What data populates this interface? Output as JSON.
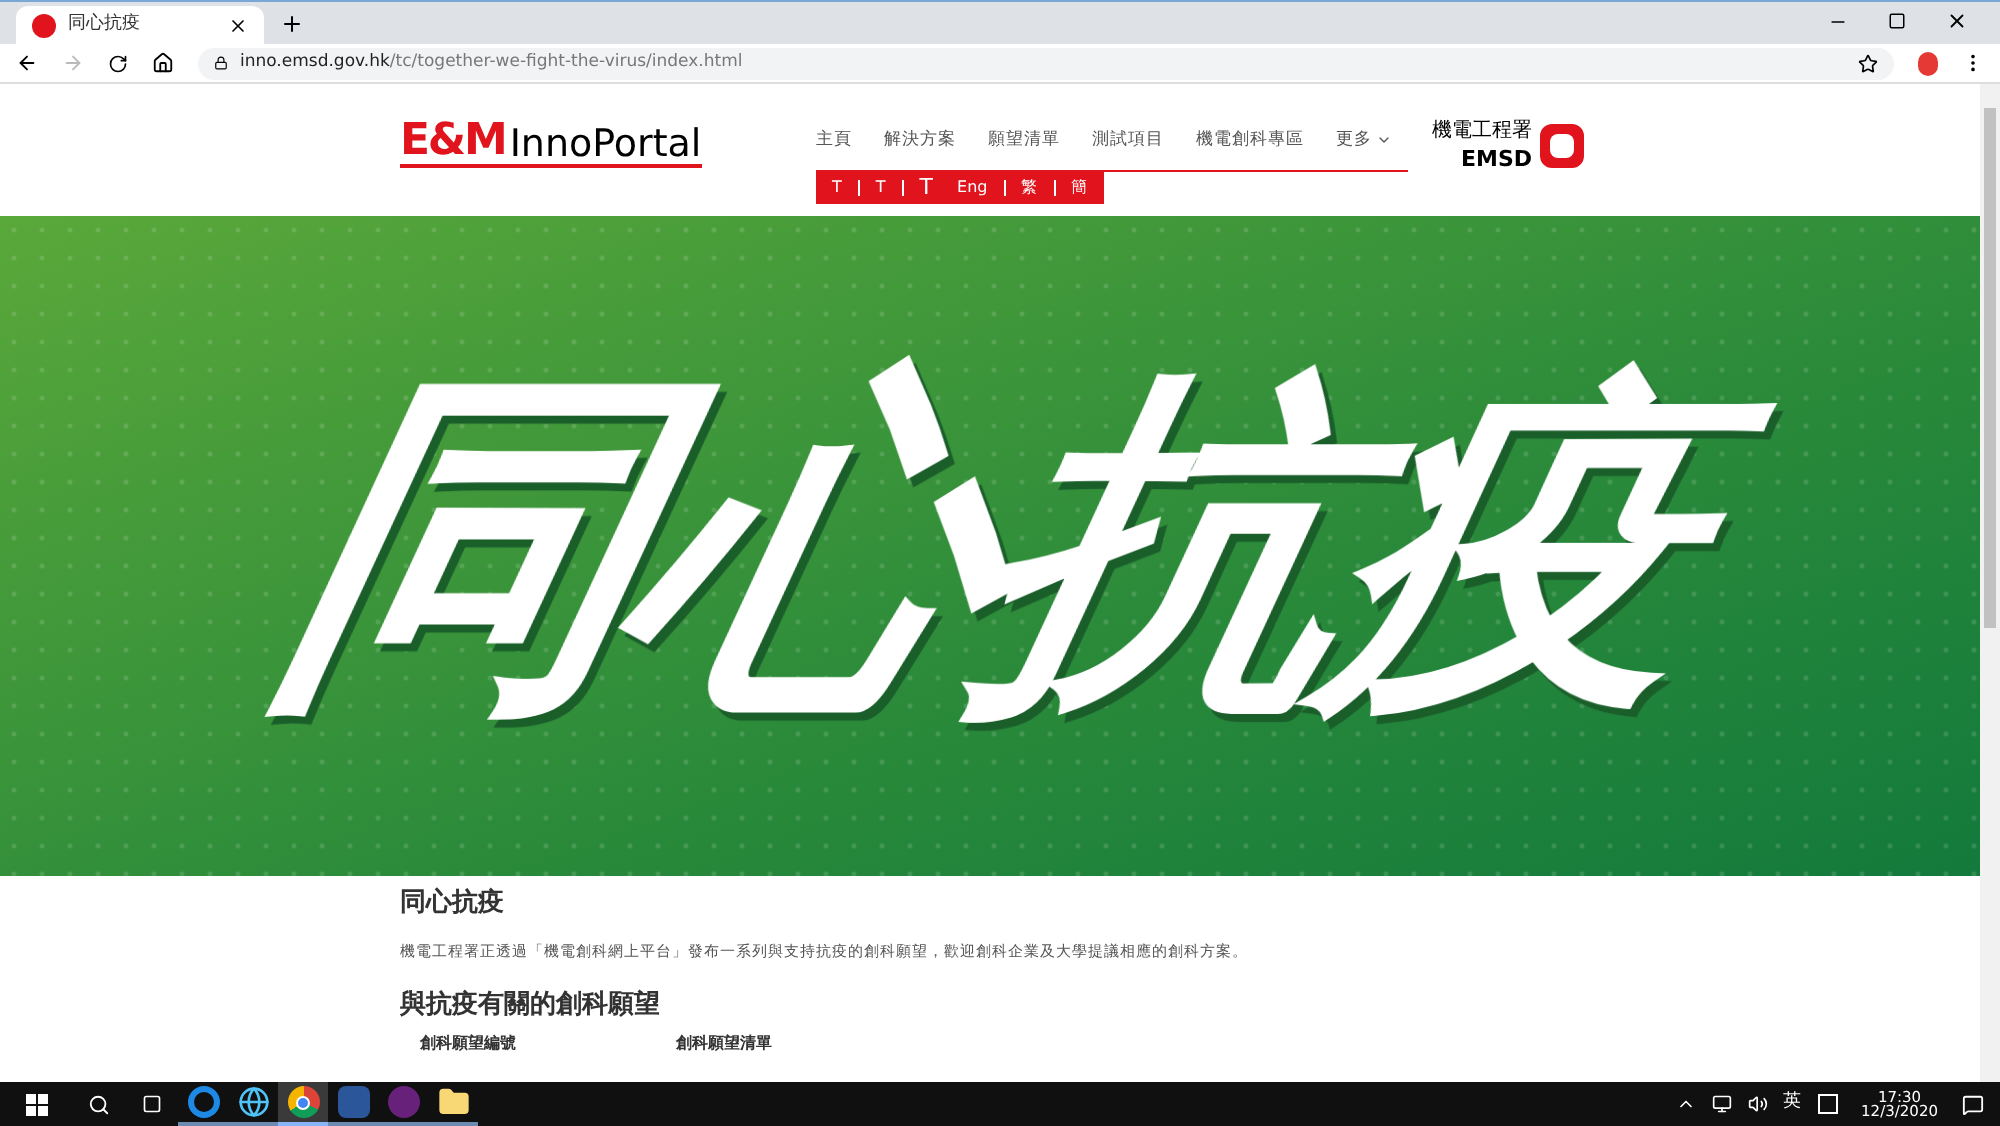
{
  "browser": {
    "tab_title": "同心抗疫",
    "url_host": "inno.emsd.gov.hk",
    "url_path": "/tc/together-we-fight-the-virus/index.html"
  },
  "header": {
    "logo_left": "E&M",
    "logo_right": "InnoPortal",
    "nav": [
      {
        "label": "主頁"
      },
      {
        "label": "解決方案"
      },
      {
        "label": "願望清單"
      },
      {
        "label": "測試項目"
      },
      {
        "label": "機電創科專區"
      },
      {
        "label": "更多",
        "dropdown": true
      }
    ],
    "tools": [
      "T",
      "T",
      "T",
      "Eng",
      "繁",
      "簡"
    ],
    "dept_name": "機電工程署",
    "dept_abbr": "EMSD"
  },
  "banner": {
    "title": "同心抗疫"
  },
  "content": {
    "heading": "同心抗疫",
    "intro": "機電工程署正透過「機電創科網上平台」發布一系列與支持抗疫的創科願望，歡迎創科企業及大學提議相應的創科方案。",
    "section_heading": "與抗疫有關的創科願望",
    "columns": [
      "創科願望編號",
      "創科願望清單"
    ]
  },
  "taskbar": {
    "apps": [
      {
        "kind": "edge",
        "selected": false
      },
      {
        "kind": "globe",
        "selected": false
      },
      {
        "kind": "chrome",
        "selected": true
      },
      {
        "kind": "word",
        "selected": false
      },
      {
        "kind": "vs",
        "selected": false
      },
      {
        "kind": "folder",
        "selected": false
      }
    ],
    "ime": "英",
    "time": "17:30",
    "date": "12/3/2020"
  }
}
